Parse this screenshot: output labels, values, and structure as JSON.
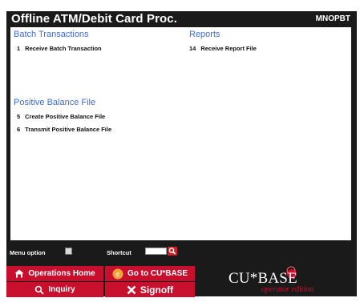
{
  "window": {
    "title": "Offline ATM/Debit Card Proc.",
    "screen_id": "MNOPBT"
  },
  "sections": {
    "batch": {
      "heading": "Batch Transactions",
      "items": [
        {
          "num": "1",
          "label": "Receive Batch Transaction"
        }
      ]
    },
    "reports": {
      "heading": "Reports",
      "items": [
        {
          "num": "14",
          "label": "Receive Report File"
        }
      ]
    },
    "positive_balance": {
      "heading": "Positive Balance File",
      "items": [
        {
          "num": "5",
          "label": "Create Positive Balance File"
        },
        {
          "num": "6",
          "label": "Transmit Positive Balance File"
        }
      ]
    }
  },
  "footer": {
    "menu_option_label": "Menu option",
    "menu_option_value": "",
    "shortcut_label": "Shortcut",
    "shortcut_value": ""
  },
  "buttons": {
    "operations_home": "Operations Home",
    "go_to_cubase": "Go to CU*BASE",
    "inquiry": "Inquiry",
    "signoff": "Signoff"
  },
  "logo": {
    "main_text": "CU*BASE",
    "sub_text": "operator edition"
  },
  "colors": {
    "background": "#1a1a1a",
    "accent": "#c8102e",
    "heading": "#3b6dd6"
  }
}
